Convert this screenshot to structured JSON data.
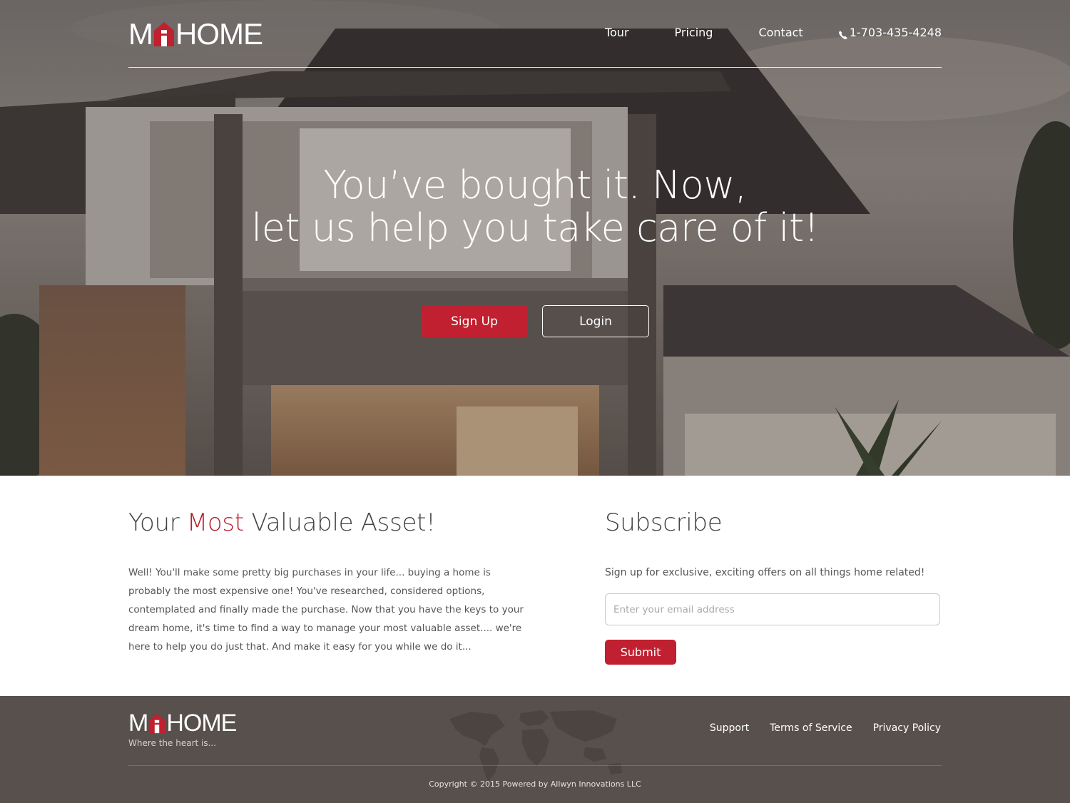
{
  "brand": {
    "logo_left": "M",
    "logo_right": "HOME",
    "accent_color": "#c0202f",
    "tagline": "Where the heart is..."
  },
  "nav": {
    "items": [
      {
        "label": "Tour"
      },
      {
        "label": "Pricing"
      },
      {
        "label": "Contact"
      }
    ],
    "phone": "1-703-435-4248",
    "phone_icon": "phone-icon"
  },
  "hero": {
    "headline_line1": "You’ve bought it. Now,",
    "headline_line2": "let us help you take care of it!",
    "signup_label": "Sign Up",
    "login_label": "Login"
  },
  "asset_section": {
    "title_pre": "Your ",
    "title_accent": "Most",
    "title_post": " Valuable Asset!",
    "body": "Well! You'll make some pretty big purchases in your life... buying a home is probably the most expensive one! You've researched, considered options, contemplated and finally made the purchase. Now that you have the keys to your dream home, it's time to find a way to manage your most valuable asset.... we're here to help you do just that. And make it easy for you while we do it..."
  },
  "subscribe": {
    "title": "Subscribe",
    "description": "Sign up for exclusive, exciting offers on all things home related!",
    "email_placeholder": "Enter your email address",
    "submit_label": "Submit"
  },
  "footer": {
    "links": [
      {
        "label": "Support"
      },
      {
        "label": "Terms of Service"
      },
      {
        "label": "Privacy Policy"
      }
    ],
    "copyright": "Copyright © 2015 Powered by Allwyn Innovations LLC",
    "background_color": "#58504d"
  }
}
